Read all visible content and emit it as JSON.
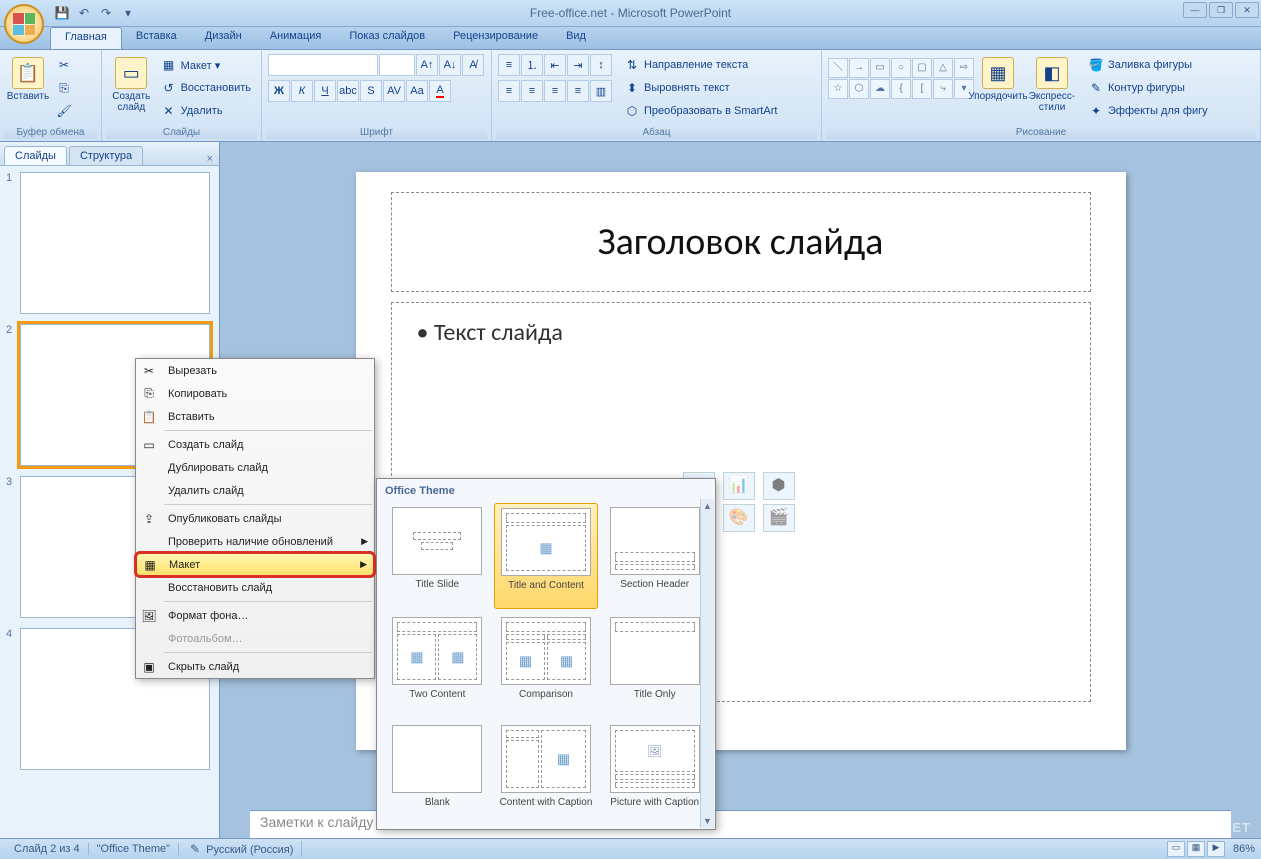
{
  "title": "Free-office.net - Microsoft PowerPoint",
  "tabs": [
    "Главная",
    "Вставка",
    "Дизайн",
    "Анимация",
    "Показ слайдов",
    "Рецензирование",
    "Вид"
  ],
  "active_tab": 0,
  "ribbon": {
    "clipboard": {
      "label": "Буфер обмена",
      "paste": "Вставить"
    },
    "slides": {
      "label": "Слайды",
      "new": "Создать\nслайд",
      "layout": "Макет ▾",
      "reset": "Восстановить",
      "delete": "Удалить"
    },
    "font": {
      "label": "Шрифт"
    },
    "paragraph": {
      "label": "Абзац",
      "textdir": "Направление текста",
      "align": "Выровнять текст",
      "smartart": "Преобразовать в SmartArt"
    },
    "drawing": {
      "label": "Рисование",
      "arrange": "Упорядочить",
      "styles": "Экспресс-стили",
      "fill": "Заливка фигуры",
      "outline": "Контур фигуры",
      "effects": "Эффекты для фигу"
    }
  },
  "panel_tabs": {
    "slides": "Слайды",
    "outline": "Структура"
  },
  "slide": {
    "title": "Заголовок слайда",
    "body": "Текст слайда"
  },
  "notes_placeholder": "Заметки к слайду",
  "context_menu": {
    "cut": "Вырезать",
    "copy": "Копировать",
    "paste": "Вставить",
    "new_slide": "Создать слайд",
    "duplicate": "Дублировать слайд",
    "delete": "Удалить слайд",
    "publish": "Опубликовать слайды",
    "check_updates": "Проверить наличие обновлений",
    "layout": "Макет",
    "reset": "Восстановить слайд",
    "format_bg": "Формат фона…",
    "photo_album": "Фотоальбом…",
    "hide": "Скрыть слайд"
  },
  "layout_flyout": {
    "header": "Office Theme",
    "items": [
      "Title Slide",
      "Title and Content",
      "Section Header",
      "Two Content",
      "Comparison",
      "Title Only",
      "Blank",
      "Content with Caption",
      "Picture with Caption"
    ],
    "selected": 1
  },
  "status": {
    "slide_count": "Слайд 2 из 4",
    "theme": "\"Office Theme\"",
    "lang": "Русский (Россия)",
    "zoom": "86%"
  },
  "watermark": "FREE-OFFICE.NET"
}
